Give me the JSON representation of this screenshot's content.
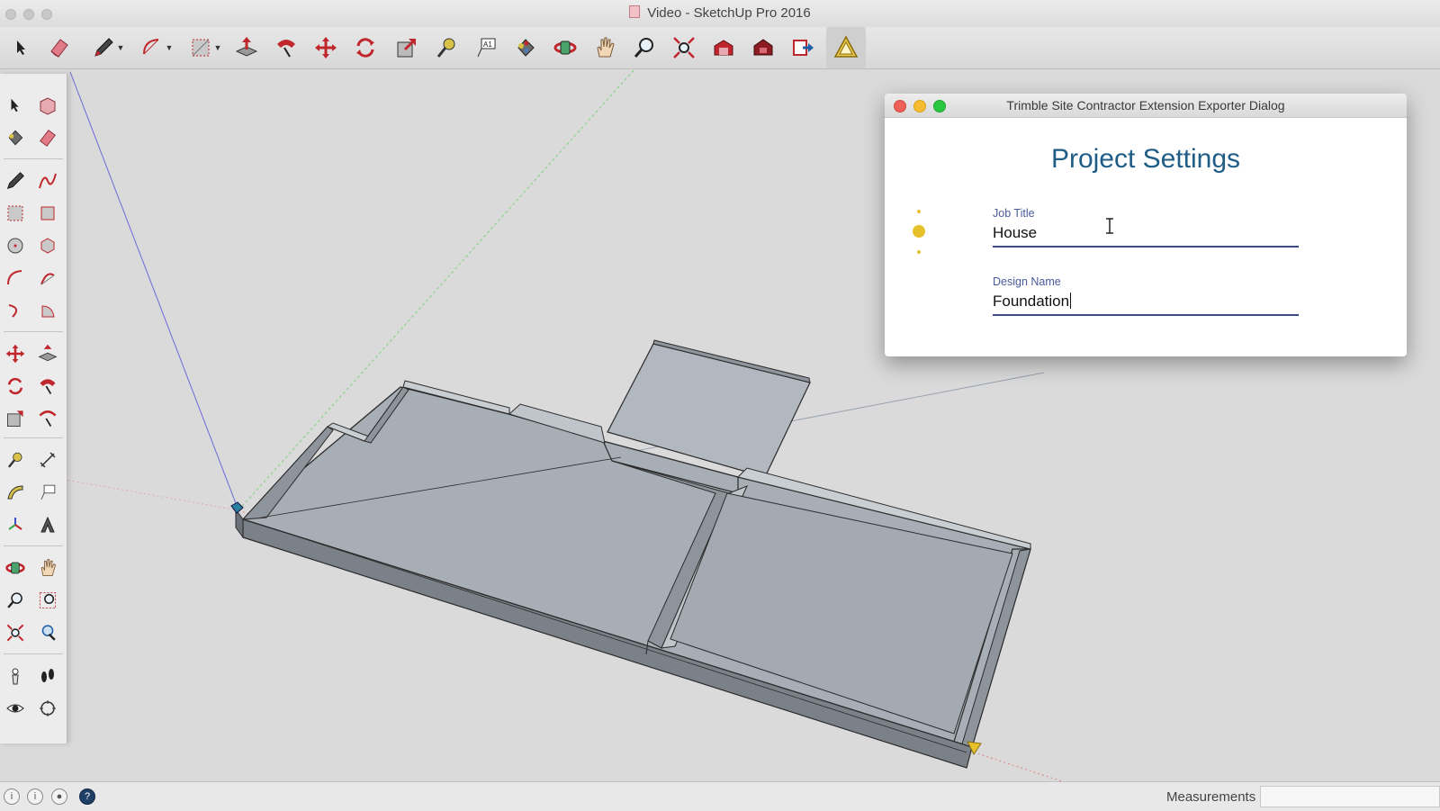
{
  "window": {
    "title": "Video - SketchUp Pro 2016"
  },
  "toolbar": {
    "tools": [
      "select-tool",
      "eraser-tool",
      "pencil-tool",
      "arc-tool",
      "rectangle-tool",
      "push-pull-tool",
      "follow-me-tool",
      "move-tool",
      "rotate-tool",
      "scale-tool",
      "tape-measure-tool",
      "text-tool",
      "paint-bucket-tool",
      "orbit-tool",
      "pan-tool",
      "zoom-tool",
      "zoom-extents-tool",
      "warehouse-tool",
      "extension-warehouse-tool",
      "layout-tool",
      "trimble-exporter-tool"
    ]
  },
  "dialog": {
    "title": "Trimble Site Contractor Extension Exporter Dialog",
    "heading": "Project Settings",
    "fields": [
      {
        "label": "Job Title",
        "value": "House"
      },
      {
        "label": "Design Name",
        "value": "Foundation"
      }
    ]
  },
  "status": {
    "measurements_label": "Measurements",
    "measurements_value": ""
  },
  "colors": {
    "accent_red": "#c0272d",
    "heading_blue": "#1f5d86",
    "field_line": "#3d4a86",
    "model_face": "#a7aeb6",
    "model_edge": "#2b2b2b",
    "dot_yellow": "#e6c12b"
  }
}
